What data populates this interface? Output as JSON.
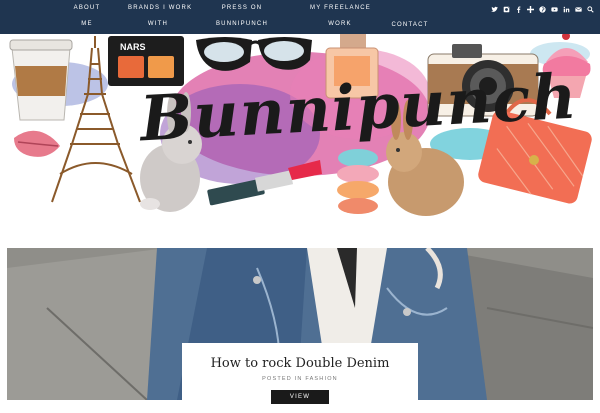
{
  "nav": {
    "items": [
      {
        "line1": "ABOUT",
        "line2": "ME"
      },
      {
        "line1": "BRANDS I WORK",
        "line2": "WITH"
      },
      {
        "line1": "PRESS ON",
        "line2": "BUNNIPUNCH"
      },
      {
        "line1": "MY FREELANCE",
        "line2": "WORK"
      },
      {
        "line1": "",
        "line2": "CONTACT"
      }
    ],
    "social_icons": [
      "twitter-icon",
      "instagram-icon",
      "facebook-icon",
      "bloglovin-icon",
      "pinterest-icon",
      "youtube-icon",
      "linkedin-icon",
      "email-icon",
      "search-icon"
    ]
  },
  "header": {
    "logo_text": "Bunnipunch"
  },
  "featured": {
    "title": "How to rock Double Denim",
    "posted_in": "POSTED IN",
    "category": "FASHION",
    "button": "VIEW"
  },
  "colors": {
    "nav_bg": "#1f3550",
    "button_bg": "#1a1a1a"
  }
}
